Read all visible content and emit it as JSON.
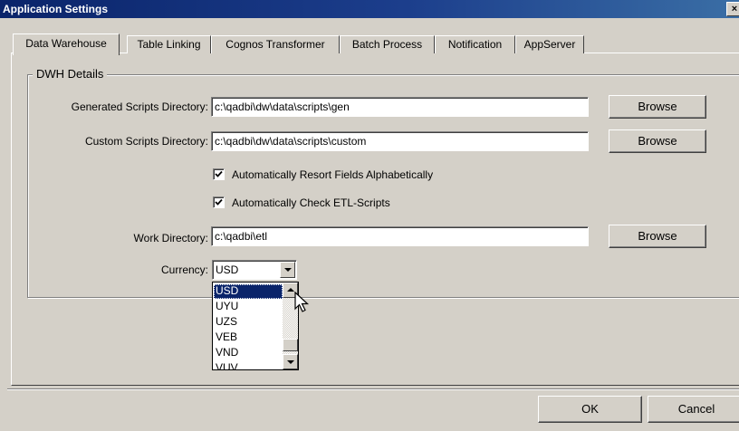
{
  "window": {
    "title": "Application Settings",
    "close_glyph": "×"
  },
  "tabs": [
    {
      "label": "Data Warehouse",
      "active": true
    },
    {
      "label": "Table Linking",
      "active": false
    },
    {
      "label": "Cognos Transformer",
      "active": false
    },
    {
      "label": "Batch Process",
      "active": false
    },
    {
      "label": "Notification",
      "active": false
    },
    {
      "label": "AppServer",
      "active": false
    }
  ],
  "dwh_details": {
    "group_label": "DWH Details",
    "generated_scripts": {
      "label": "Generated Scripts Directory:",
      "value": "c:\\qadbi\\dw\\data\\scripts\\gen",
      "browse_label": "Browse"
    },
    "custom_scripts": {
      "label": "Custom Scripts Directory:",
      "value": "c:\\qadbi\\dw\\data\\scripts\\custom",
      "browse_label": "Browse"
    },
    "resort_fields": {
      "label": "Automatically Resort Fields Alphabetically",
      "checked": true
    },
    "check_etl": {
      "label": "Automatically Check ETL-Scripts",
      "checked": true
    },
    "work_directory": {
      "label": "Work Directory:",
      "value": "c:\\qadbi\\etl",
      "browse_label": "Browse"
    },
    "currency": {
      "label": "Currency:",
      "value": "USD",
      "options": [
        "USD",
        "UYU",
        "UZS",
        "VEB",
        "VND",
        "VUV"
      ],
      "highlighted": "USD"
    }
  },
  "footer": {
    "ok_label": "OK",
    "cancel_label": "Cancel"
  },
  "colors": {
    "dialog_bg": "#d4d0c8",
    "title_bar": "#0a246a",
    "selection": "#0a246a"
  }
}
